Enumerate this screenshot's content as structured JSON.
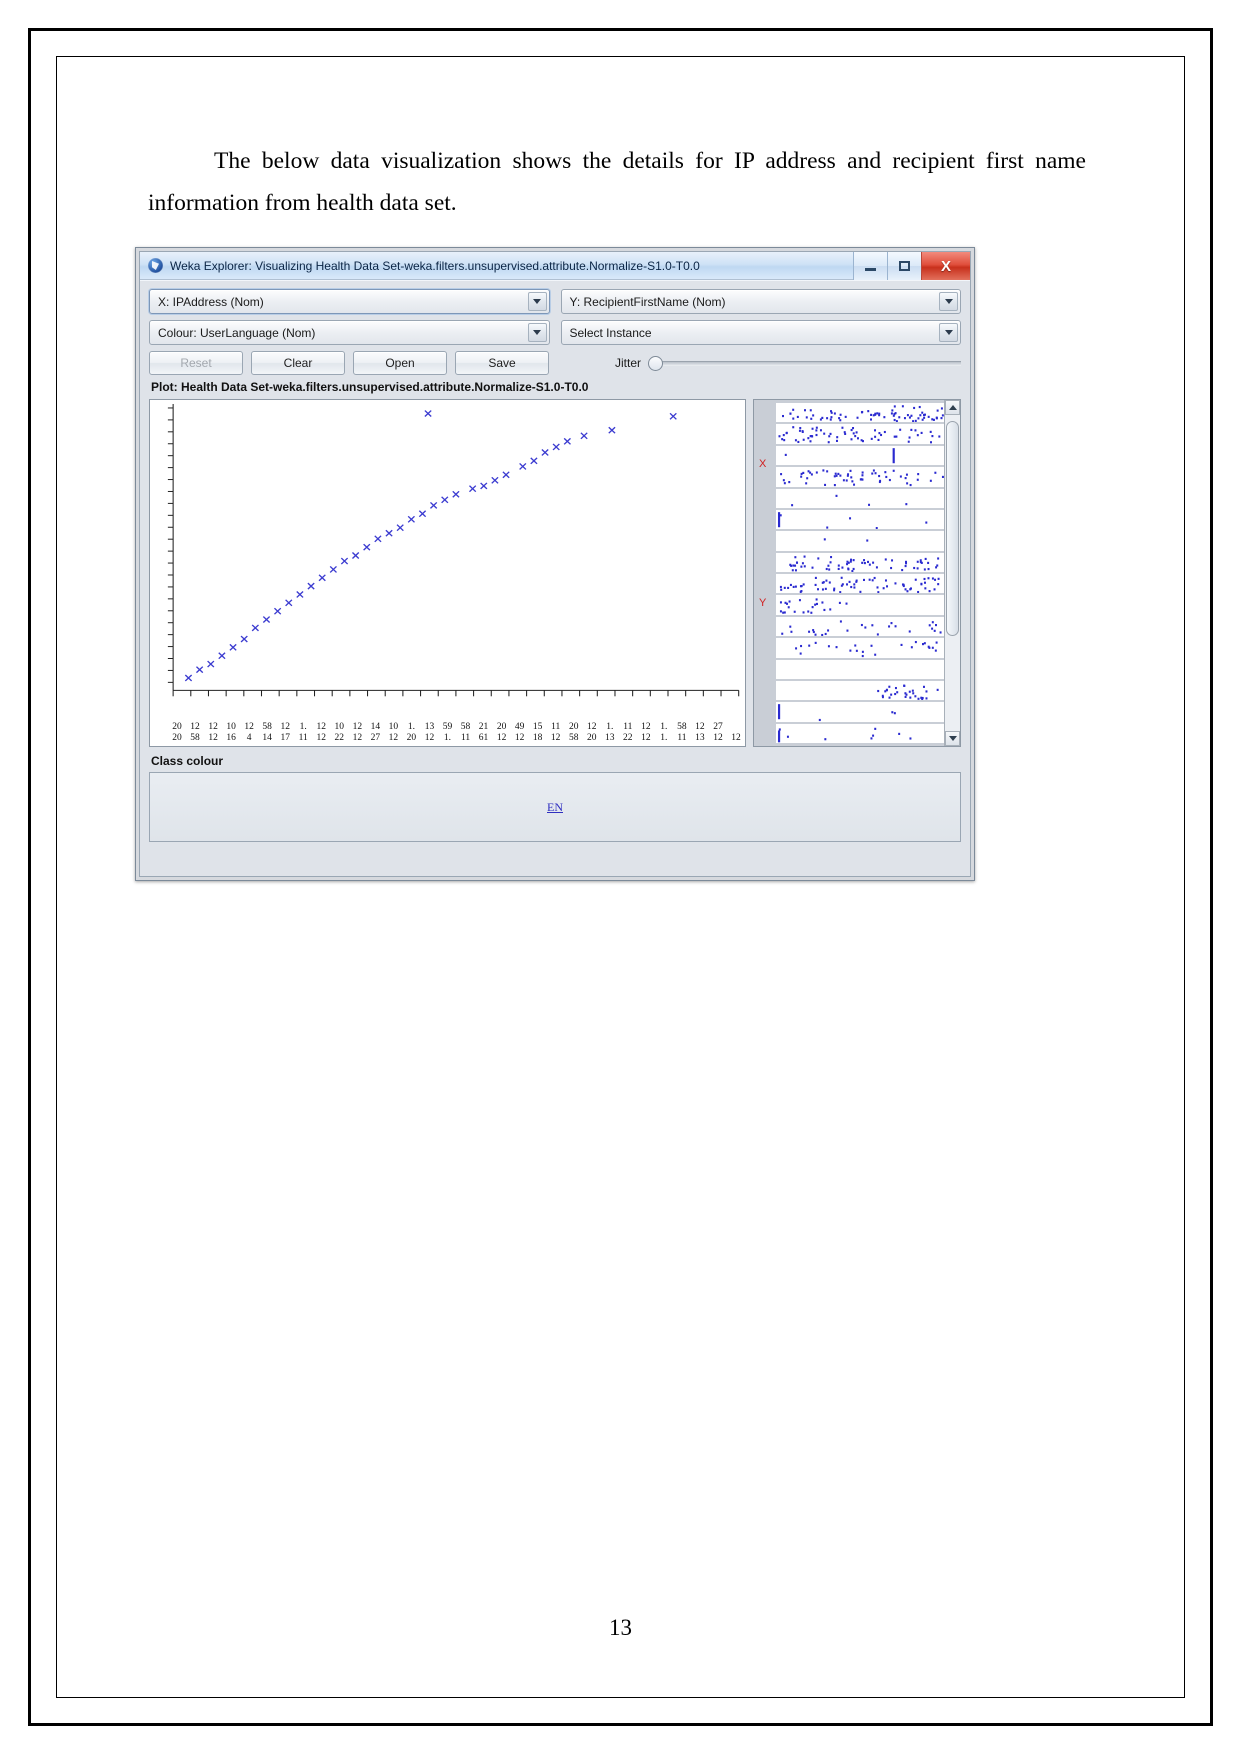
{
  "document": {
    "paragraph_indent": " ",
    "paragraph": "The below data visualization shows the details for IP address and recipient first name information from health data set.",
    "page_number": "13"
  },
  "window": {
    "title": "Weka Explorer: Visualizing Health Data Set-weka.filters.unsupervised.attribute.Normalize-S1.0-T0.0",
    "logo_icon": "weka-bird-icon",
    "controls": {
      "minimize": "minimize-icon",
      "maximize": "maximize-icon",
      "close": "X"
    }
  },
  "controls": {
    "x_axis_combo": "X: IPAddress (Nom)",
    "y_axis_combo": "Y: RecipientFirstName (Nom)",
    "colour_combo": "Colour: UserLanguage (Nom)",
    "select_instance_combo": "Select Instance",
    "buttons": [
      {
        "label": "Reset",
        "disabled": true
      },
      {
        "label": "Clear",
        "disabled": false
      },
      {
        "label": "Open",
        "disabled": false
      },
      {
        "label": "Save",
        "disabled": false
      }
    ],
    "jitter_label": "Jitter",
    "jitter_value": 0
  },
  "plot": {
    "title": "Plot: Health Data Set-weka.filters.unsupervised.attribute.Normalize-S1.0-T0.0",
    "x_tick_labels": [
      "20\n20",
      "12\n58",
      "12\n12",
      "10\n16",
      "12\n4",
      "58\n14",
      "12\n17",
      "1.\n11",
      "12\n12",
      "10\n22",
      "12\n12",
      "14\n27",
      "10\n12",
      "1.\n20",
      "13\n12",
      "59\n1.",
      "58\n11",
      "21\n61",
      "20\n12",
      "49\n12",
      "15\n18",
      "11\n12",
      "20\n58",
      "12\n20",
      "1.\n13",
      "11\n22",
      "12\n12",
      "1.\n1.",
      "58\n11",
      "12\n13",
      "27\n12",
      "\n12"
    ]
  },
  "attribute_panel": {
    "x_marker": "X",
    "y_marker": "Y",
    "scroll_up_icon": "triangle-up-icon",
    "scroll_down_icon": "triangle-down-icon"
  },
  "class_colour": {
    "heading": "Class colour",
    "entries": [
      "EN"
    ]
  },
  "chart_data": {
    "type": "scatter",
    "title": "Plot: Health Data Set-weka.filters.unsupervised.attribute.Normalize-S1.0-T0.0",
    "xlabel": "IPAddress (Nom)",
    "ylabel": "RecipientFirstName (Nom)",
    "marker": "x",
    "marker_color": "#3b3bd0",
    "grid": false,
    "legend_position": "bottom",
    "series": [
      {
        "name": "EN",
        "points": [
          [
            0.02,
            0.03
          ],
          [
            0.04,
            0.06
          ],
          [
            0.06,
            0.08
          ],
          [
            0.08,
            0.11
          ],
          [
            0.1,
            0.14
          ],
          [
            0.12,
            0.17
          ],
          [
            0.14,
            0.21
          ],
          [
            0.16,
            0.24
          ],
          [
            0.18,
            0.27
          ],
          [
            0.2,
            0.3
          ],
          [
            0.22,
            0.33
          ],
          [
            0.24,
            0.36
          ],
          [
            0.26,
            0.39
          ],
          [
            0.28,
            0.42
          ],
          [
            0.3,
            0.45
          ],
          [
            0.32,
            0.47
          ],
          [
            0.34,
            0.5
          ],
          [
            0.36,
            0.53
          ],
          [
            0.38,
            0.55
          ],
          [
            0.4,
            0.57
          ],
          [
            0.42,
            0.6
          ],
          [
            0.44,
            0.62
          ],
          [
            0.46,
            0.65
          ],
          [
            0.48,
            0.67
          ],
          [
            0.5,
            0.69
          ],
          [
            0.53,
            0.71
          ],
          [
            0.55,
            0.72
          ],
          [
            0.57,
            0.74
          ],
          [
            0.59,
            0.76
          ],
          [
            0.62,
            0.79
          ],
          [
            0.64,
            0.81
          ],
          [
            0.66,
            0.84
          ],
          [
            0.68,
            0.86
          ],
          [
            0.7,
            0.88
          ],
          [
            0.45,
            0.98
          ],
          [
            0.73,
            0.9
          ],
          [
            0.78,
            0.92
          ],
          [
            0.89,
            0.97
          ]
        ]
      }
    ],
    "xlim": [
      0,
      1
    ],
    "ylim": [
      0,
      1
    ]
  }
}
